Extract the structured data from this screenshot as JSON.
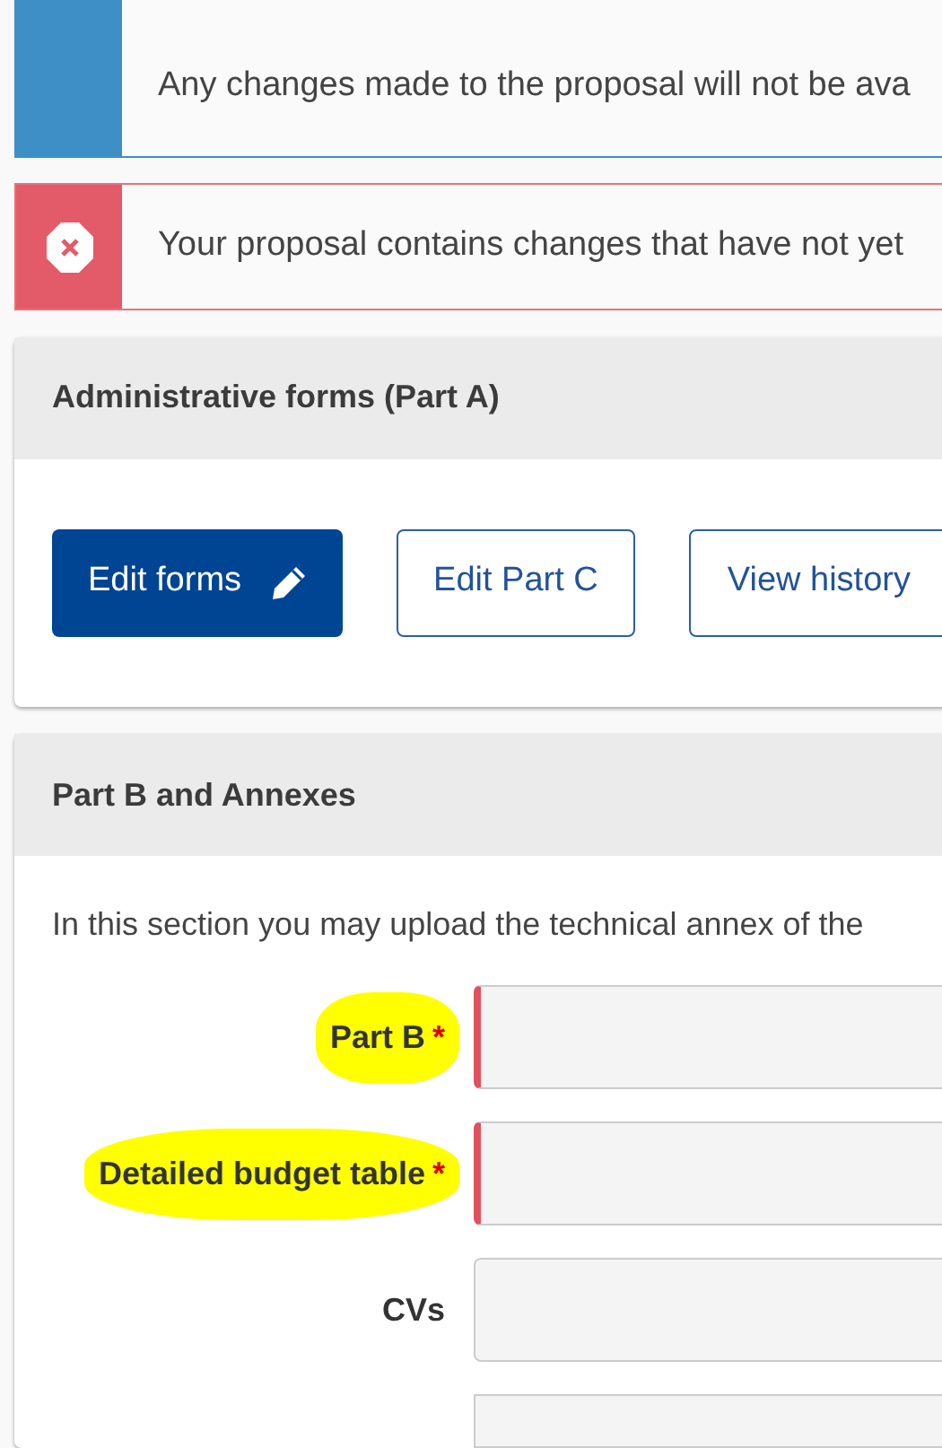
{
  "alerts": [
    {
      "kind": "info",
      "lines": [
        "Any changes made to the proposal will not be ava"
      ]
    },
    {
      "kind": "error",
      "lines": [
        "Your proposal contains changes that have not yet"
      ]
    }
  ],
  "admin_card": {
    "title": "Administrative forms (Part A)",
    "buttons": [
      {
        "label": "Edit forms",
        "kind": "primary"
      },
      {
        "label": "Edit Part C",
        "kind": "outline"
      },
      {
        "label": "View history",
        "kind": "outline"
      }
    ]
  },
  "partb_card": {
    "title": "Part B and Annexes",
    "intro": "In this section you may upload the technical annex of the",
    "fields": [
      {
        "label": "Part B",
        "required": true,
        "asterisk": "*",
        "highlighted": true
      },
      {
        "label": "Detailed budget table",
        "required": true,
        "asterisk": "*",
        "highlighted": true
      },
      {
        "label": "CVs",
        "required": false,
        "highlighted": false
      }
    ]
  }
}
